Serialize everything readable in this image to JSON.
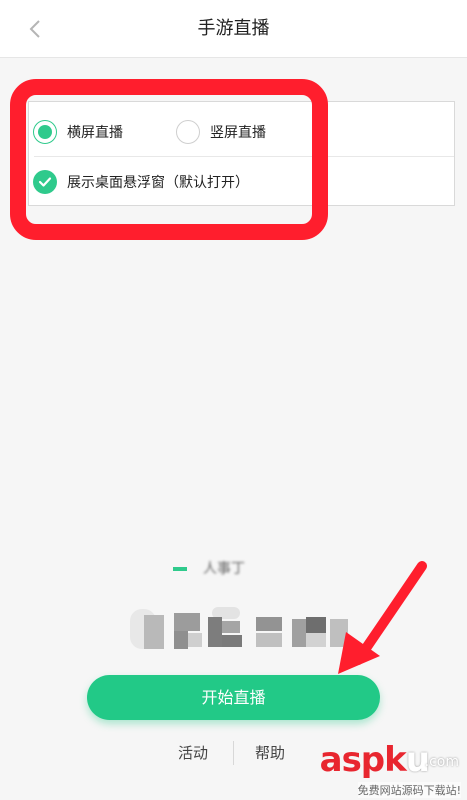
{
  "header": {
    "title": "手游直播",
    "back_icon": "chevron-left-icon"
  },
  "options": {
    "landscape_label": "横屏直播",
    "landscape_selected": true,
    "portrait_label": "竖屏直播",
    "portrait_selected": false,
    "floating_window_label": "展示桌面悬浮窗（默认打开）",
    "floating_window_checked": true
  },
  "account": {
    "name_blurred": "人事丁"
  },
  "start_button": {
    "label": "开始直播"
  },
  "bottom_links": {
    "activity": "活动",
    "help": "帮助"
  },
  "watermark": {
    "brand_main": "asp",
    "brand_k": "k",
    "brand_u": "u",
    "brand_com": ".com",
    "sub": "免费网站源码下载站!"
  },
  "colors": {
    "accent": "#22c987",
    "annotation_red": "#ff1e2d"
  }
}
